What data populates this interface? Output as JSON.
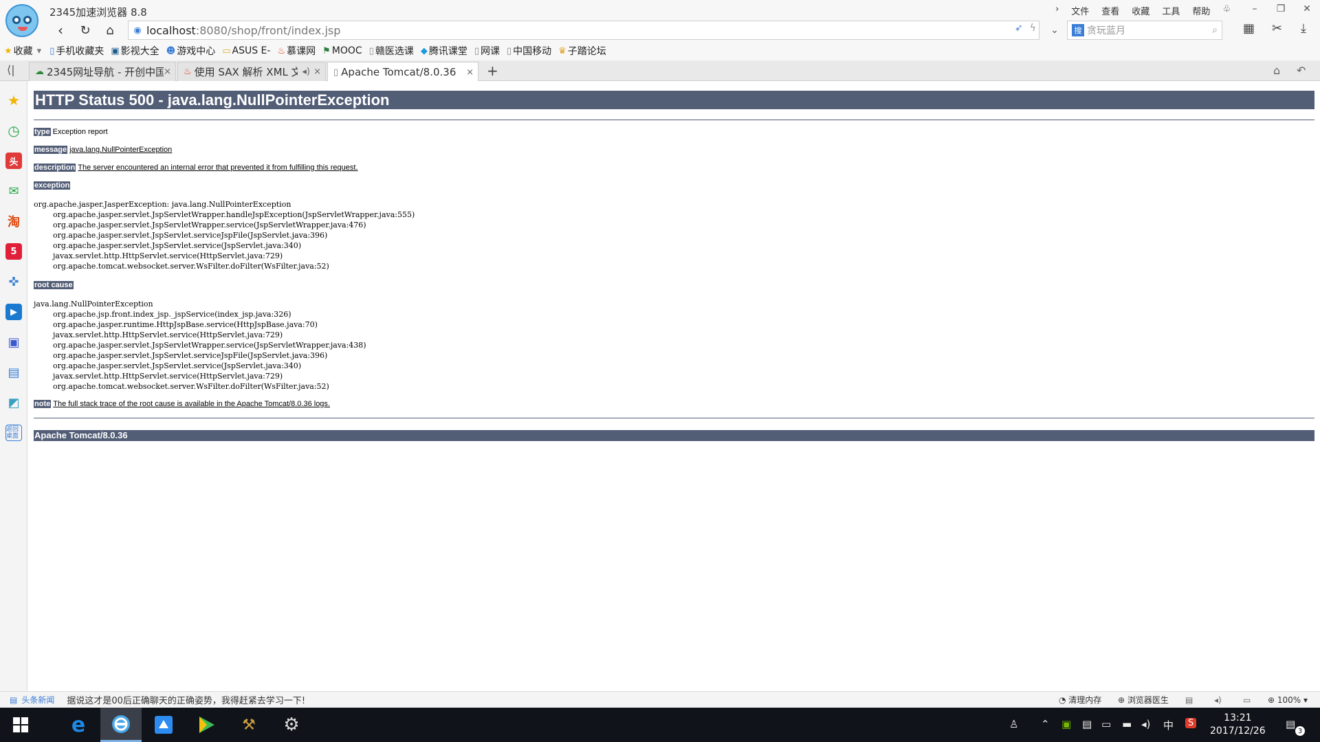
{
  "window": {
    "title": "2345加速浏览器 8.8",
    "menu": [
      "文件",
      "查看",
      "收藏",
      "工具",
      "帮助"
    ]
  },
  "address": {
    "host": "localhost",
    "path": ":8080/shop/front/index.jsp",
    "search_placeholder": "贪玩蓝月"
  },
  "bookmarks": [
    "收藏",
    "手机收藏夹",
    "影视大全",
    "游戏中心",
    "ASUS E-",
    "慕课网",
    "MOOC",
    "赣医选课",
    "腾讯课堂",
    "网课",
    "中国移动",
    "子踏论坛"
  ],
  "tabs": [
    {
      "label": "2345网址导航 - 开创中国",
      "active": false
    },
    {
      "label": "使用 SAX 解析 XML 文",
      "active": false
    },
    {
      "label": "Apache Tomcat/8.0.36",
      "active": true
    }
  ],
  "page": {
    "heading": "HTTP Status 500 - java.lang.NullPointerException",
    "type_label": "type",
    "type_value": "Exception report",
    "message_label": "message",
    "message_value": "java.lang.NullPointerException",
    "description_label": "description",
    "description_value": "The server encountered an internal error that prevented it from fulfilling this request.",
    "exception_label": "exception",
    "exception_trace": "org.apache.jasper.JasperException: java.lang.NullPointerException\n\torg.apache.jasper.servlet.JspServletWrapper.handleJspException(JspServletWrapper.java:555)\n\torg.apache.jasper.servlet.JspServletWrapper.service(JspServletWrapper.java:476)\n\torg.apache.jasper.servlet.JspServlet.serviceJspFile(JspServlet.java:396)\n\torg.apache.jasper.servlet.JspServlet.service(JspServlet.java:340)\n\tjavax.servlet.http.HttpServlet.service(HttpServlet.java:729)\n\torg.apache.tomcat.websocket.server.WsFilter.doFilter(WsFilter.java:52)",
    "root_cause_label": "root cause",
    "root_cause_trace": "java.lang.NullPointerException\n\torg.apache.jsp.front.index_jsp._jspService(index_jsp.java:326)\n\torg.apache.jasper.runtime.HttpJspBase.service(HttpJspBase.java:70)\n\tjavax.servlet.http.HttpServlet.service(HttpServlet.java:729)\n\torg.apache.jasper.servlet.JspServletWrapper.service(JspServletWrapper.java:438)\n\torg.apache.jasper.servlet.JspServlet.serviceJspFile(JspServlet.java:396)\n\torg.apache.jasper.servlet.JspServlet.service(JspServlet.java:340)\n\tjavax.servlet.http.HttpServlet.service(HttpServlet.java:729)\n\torg.apache.tomcat.websocket.server.WsFilter.doFilter(WsFilter.java:52)",
    "note_label": "note",
    "note_value": "The full stack trace of the root cause is available in the Apache Tomcat/8.0.36 logs.",
    "footer": "Apache Tomcat/8.0.36"
  },
  "statusbar": {
    "news_label": "头条新闻",
    "news_text": "据说这才是00后正确聊天的正确姿势，我得赶紧去学习一下!",
    "clean_memory": "清理内存",
    "browser_doctor": "浏览器医生",
    "zoom": "100%"
  },
  "taskbar": {
    "ime": "中",
    "time": "13:21",
    "date": "2017/12/26",
    "notifications": "3"
  }
}
